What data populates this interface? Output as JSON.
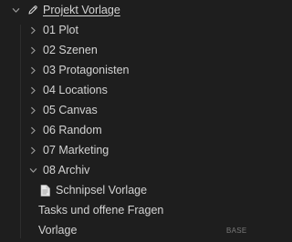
{
  "root": {
    "label": "Projekt Vorlage",
    "expanded": true,
    "icon": "pencil-icon"
  },
  "folders": [
    {
      "label": "01 Plot",
      "expanded": false
    },
    {
      "label": "02 Szenen",
      "expanded": false
    },
    {
      "label": "03 Protagonisten",
      "expanded": false
    },
    {
      "label": "04 Locations",
      "expanded": false
    },
    {
      "label": "05 Canvas",
      "expanded": false
    },
    {
      "label": "06 Random",
      "expanded": false
    },
    {
      "label": "07 Marketing",
      "expanded": false
    },
    {
      "label": "08 Archiv",
      "expanded": true
    }
  ],
  "archiv_children": [
    {
      "label": "Schnipsel Vorlage",
      "icon": "document-icon"
    }
  ],
  "files": [
    {
      "label": "Tasks und offene Fragen"
    },
    {
      "label": "Vorlage",
      "badge": "BASE"
    }
  ],
  "colors": {
    "background": "#1e1e1e",
    "text": "#d4d4d4",
    "chevron": "#9a9a9a",
    "badge": "#7a7a7a"
  }
}
